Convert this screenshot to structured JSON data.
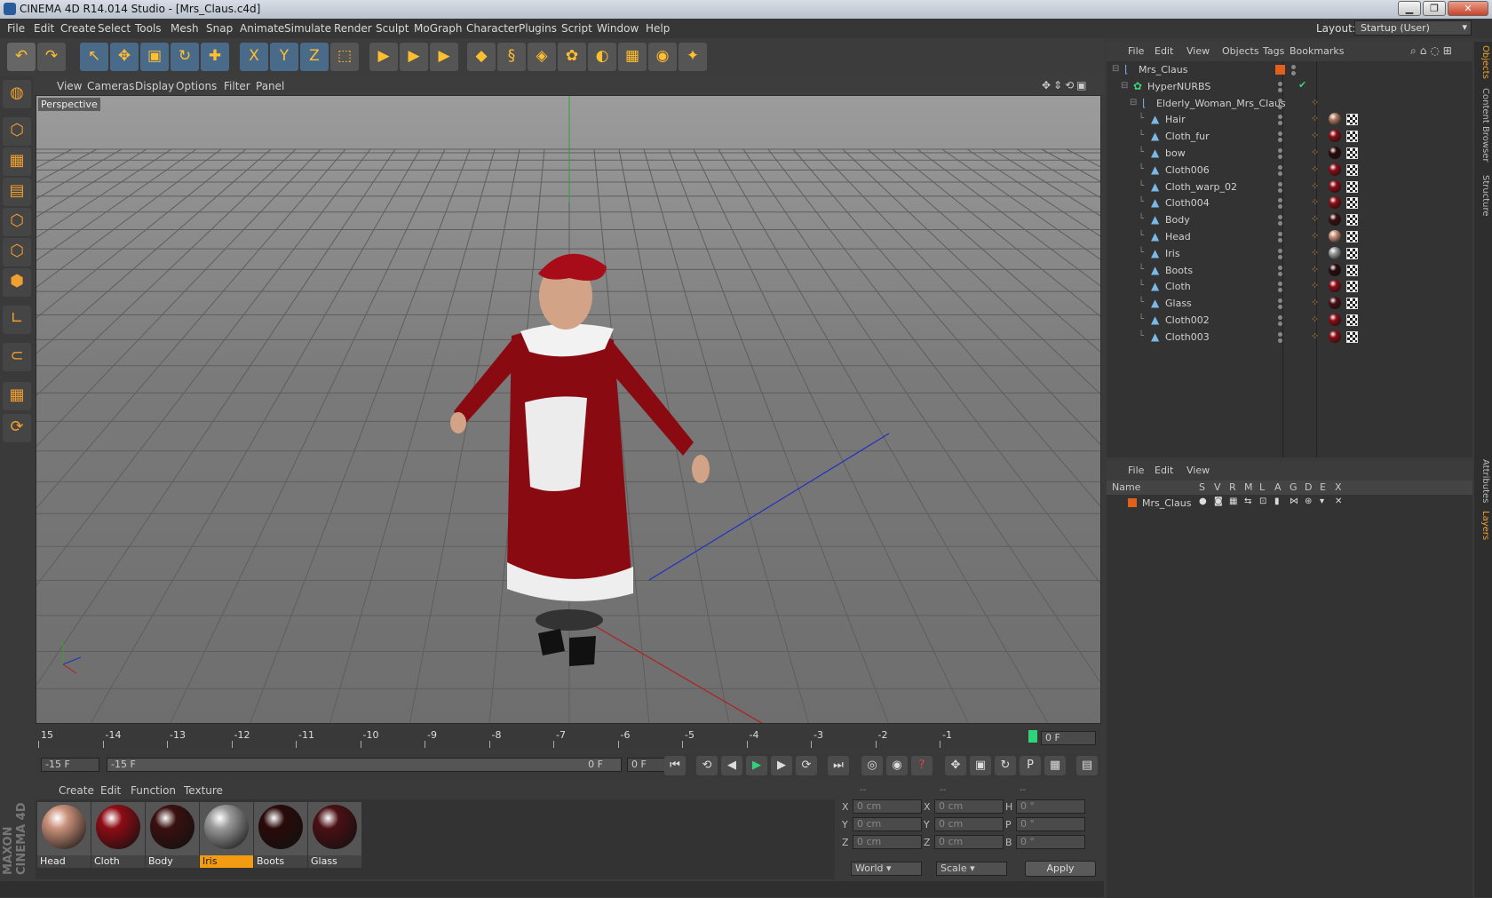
{
  "window": {
    "title": "CINEMA 4D R14.014 Studio - [Mrs_Claus.c4d]",
    "min": "▁",
    "max": "❐",
    "close": "✕"
  },
  "menu": [
    "File",
    "Edit",
    "Create",
    "Select",
    "Tools",
    "Mesh",
    "Snap",
    "Animate",
    "Simulate",
    "Render",
    "Sculpt",
    "MoGraph",
    "Character",
    "Plugins",
    "Script",
    "Window",
    "Help"
  ],
  "layout": {
    "label": "Layout:",
    "value": "Startup (User)"
  },
  "viewport": {
    "menu": [
      "View",
      "Cameras",
      "Display",
      "Options",
      "Filter",
      "Panel"
    ],
    "label": "Perspective"
  },
  "timeline": {
    "ticks": [
      "15",
      "-14",
      "-13",
      "-12",
      "-11",
      "-10",
      "-9",
      "-8",
      "-7",
      "-6",
      "-5",
      "-4",
      "-3",
      "-2",
      "-1"
    ],
    "current": "0 F"
  },
  "controls": {
    "start": "-15 F",
    "range_start": "-15 F",
    "range_end": "0 F",
    "end": "0 F"
  },
  "material_menu": [
    "Create",
    "Edit",
    "Function",
    "Texture"
  ],
  "materials": [
    {
      "name": "Head",
      "color": "#c9917a",
      "selected": false
    },
    {
      "name": "Cloth",
      "color": "#8e0c14",
      "selected": false
    },
    {
      "name": "Body",
      "color": "#3a1010",
      "selected": false
    },
    {
      "name": "Iris",
      "color": "#9a9a9a",
      "selected": true
    },
    {
      "name": "Boots",
      "color": "#2a0a0a",
      "selected": false
    },
    {
      "name": "Glass",
      "color": "#4a1014",
      "selected": false
    }
  ],
  "coords": {
    "header": [
      "--",
      "--",
      "--"
    ],
    "rows": [
      {
        "a": "X",
        "av": "0 cm",
        "b": "X",
        "bv": "0 cm",
        "c": "H",
        "cv": "0 °"
      },
      {
        "a": "Y",
        "av": "0 cm",
        "b": "Y",
        "bv": "0 cm",
        "c": "P",
        "cv": "0 °"
      },
      {
        "a": "Z",
        "av": "0 cm",
        "b": "Z",
        "bv": "0 cm",
        "c": "B",
        "cv": "0 °"
      }
    ],
    "world": "World",
    "scale": "Scale",
    "apply": "Apply"
  },
  "objects_menu": [
    "File",
    "Edit",
    "View",
    "Objects",
    "Tags",
    "Bookmarks"
  ],
  "objects": [
    {
      "name": "Mrs_Claus",
      "level": 0,
      "icon": "null"
    },
    {
      "name": "HyperNURBS",
      "level": 1,
      "icon": "nurbs"
    },
    {
      "name": "Elderly_Woman_Mrs_Claus",
      "level": 2,
      "icon": "null"
    },
    {
      "name": "Hair",
      "level": 3,
      "icon": "mesh",
      "tag": "#b07a60"
    },
    {
      "name": "Cloth_fur",
      "level": 3,
      "icon": "mesh",
      "tag": "#8e0c14"
    },
    {
      "name": "bow",
      "level": 3,
      "icon": "mesh",
      "tag": "#2a0a0a"
    },
    {
      "name": "Cloth006",
      "level": 3,
      "icon": "mesh",
      "tag": "#8e0c14"
    },
    {
      "name": "Cloth_warp_02",
      "level": 3,
      "icon": "mesh",
      "tag": "#8e0c14"
    },
    {
      "name": "Cloth004",
      "level": 3,
      "icon": "mesh",
      "tag": "#8e0c14"
    },
    {
      "name": "Body",
      "level": 3,
      "icon": "mesh",
      "tag": "#3a1010"
    },
    {
      "name": "Head",
      "level": 3,
      "icon": "mesh",
      "tag": "#c9917a"
    },
    {
      "name": "Iris",
      "level": 3,
      "icon": "mesh",
      "tag": "#9a9a9a"
    },
    {
      "name": "Boots",
      "level": 3,
      "icon": "mesh",
      "tag": "#2a0a0a"
    },
    {
      "name": "Cloth",
      "level": 3,
      "icon": "mesh",
      "tag": "#8e0c14"
    },
    {
      "name": "Glass",
      "level": 3,
      "icon": "mesh",
      "tag": "#4a1014"
    },
    {
      "name": "Cloth002",
      "level": 3,
      "icon": "mesh",
      "tag": "#8e0c14"
    },
    {
      "name": "Cloth003",
      "level": 3,
      "icon": "mesh",
      "tag": "#8e0c14"
    }
  ],
  "layers_menu": [
    "File",
    "Edit",
    "View"
  ],
  "layers_header": {
    "name": "Name",
    "cols": [
      "S",
      "V",
      "R",
      "M",
      "L",
      "A",
      "G",
      "D",
      "E",
      "X"
    ]
  },
  "layers": [
    {
      "name": "Mrs_Claus",
      "color": "#e0601c"
    }
  ],
  "side_tabs": [
    "Objects",
    "Content Browser",
    "Structure",
    "Attributes",
    "Layers"
  ],
  "brand": "MAXON CINEMA 4D"
}
